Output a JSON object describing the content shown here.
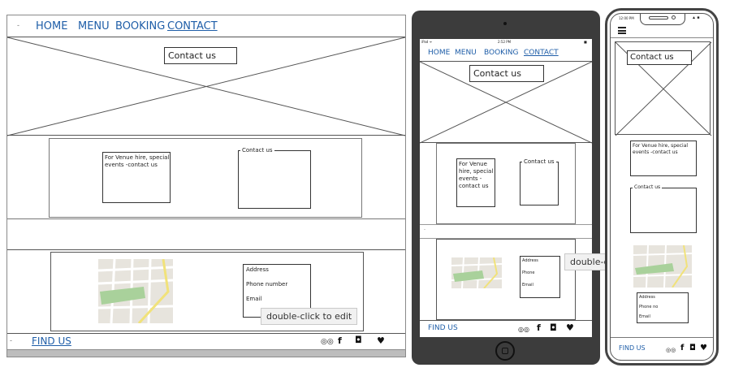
{
  "desktop": {
    "nav": {
      "dot": "-",
      "home": "HOME",
      "menu": "MENU",
      "booking": "BOOKING",
      "contact": "CONTACT"
    },
    "hero_title": "Contact us",
    "venue_text": "For Venue hire, special events -contact us",
    "form_legend": "Contact us",
    "info": {
      "address": "Address",
      "phone": "Phone number",
      "email": "Email"
    },
    "tooltip": "double-click to edit",
    "footer": {
      "dot": "-",
      "find_us": "FIND US"
    }
  },
  "tablet": {
    "status": {
      "left": "iPad ᯤ",
      "time": "2:52 PM",
      "battery": "■"
    },
    "nav": {
      "home": "HOME",
      "menu": "MENU",
      "booking": "BOOKING",
      "contact": "CONTACT"
    },
    "hero_title": "Contact us",
    "venue_text": "For Venue hire, special events -contact us",
    "form_legend": "Contact us",
    "info": {
      "address": "Address",
      "phone": "Phone",
      "email": "Email"
    },
    "tooltip": "double-cli",
    "footer": {
      "find_us": "FIND US"
    },
    "separator": "-"
  },
  "phone": {
    "status": {
      "time": "12:00 PM"
    },
    "hero_title": "Contact us",
    "venue_text": "For Venue hire, special events -contact us",
    "form_legend": "Contact us",
    "info": {
      "address": "Address",
      "phone": "Phone no",
      "email": "Email"
    },
    "footer": {
      "find_us": "FIND US"
    }
  },
  "icons": {
    "tripadvisor": "tripadvisor-icon",
    "facebook": "facebook-icon",
    "instagram": "instagram-icon",
    "twitter": "twitter-icon",
    "hamburger": "hamburger-icon"
  },
  "colors": {
    "link": "#1f5ea8",
    "tablet_frame": "#3c3c3c",
    "map_park": "#a9d19b",
    "map_road": "#f1e27a"
  }
}
